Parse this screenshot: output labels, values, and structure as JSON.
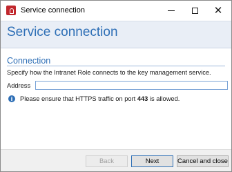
{
  "window": {
    "title": "Service connection",
    "icon": "lock-icon",
    "controls": {
      "minimize": "minimize-icon",
      "maximize": "maximize-icon",
      "close": "close-icon"
    }
  },
  "header": {
    "title": "Service connection"
  },
  "section": {
    "title": "Connection",
    "description": "Specify how the Intranet Role connects to the key management service."
  },
  "address": {
    "label": "Address",
    "value": "",
    "placeholder": ""
  },
  "info": {
    "icon": "info-icon",
    "text_before": "Please ensure that HTTPS traffic on port ",
    "port": "443",
    "text_after": " is allowed."
  },
  "buttons": {
    "back": "Back",
    "next": "Next",
    "cancel": "Cancel and close"
  },
  "colors": {
    "accent": "#2e6fb6",
    "header_bg": "#e9eef6",
    "app_icon": "#c1272d"
  }
}
